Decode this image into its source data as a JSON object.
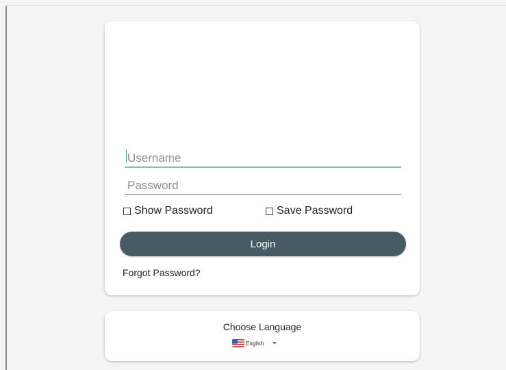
{
  "login_form": {
    "username_placeholder": "Username",
    "password_placeholder": "Password",
    "show_password_label": "Show Password",
    "save_password_label": "Save Password",
    "login_button_label": "Login",
    "forgot_password_label": "Forgot Password?"
  },
  "language": {
    "title": "Choose Language",
    "selected_label": "English",
    "flag_icon": "us-flag-icon",
    "dropdown_icon": "chevron-down-icon"
  },
  "colors": {
    "login_button": "#475b65",
    "active_underline": "#7fbfbd",
    "page_background": "#f5f5f5"
  }
}
